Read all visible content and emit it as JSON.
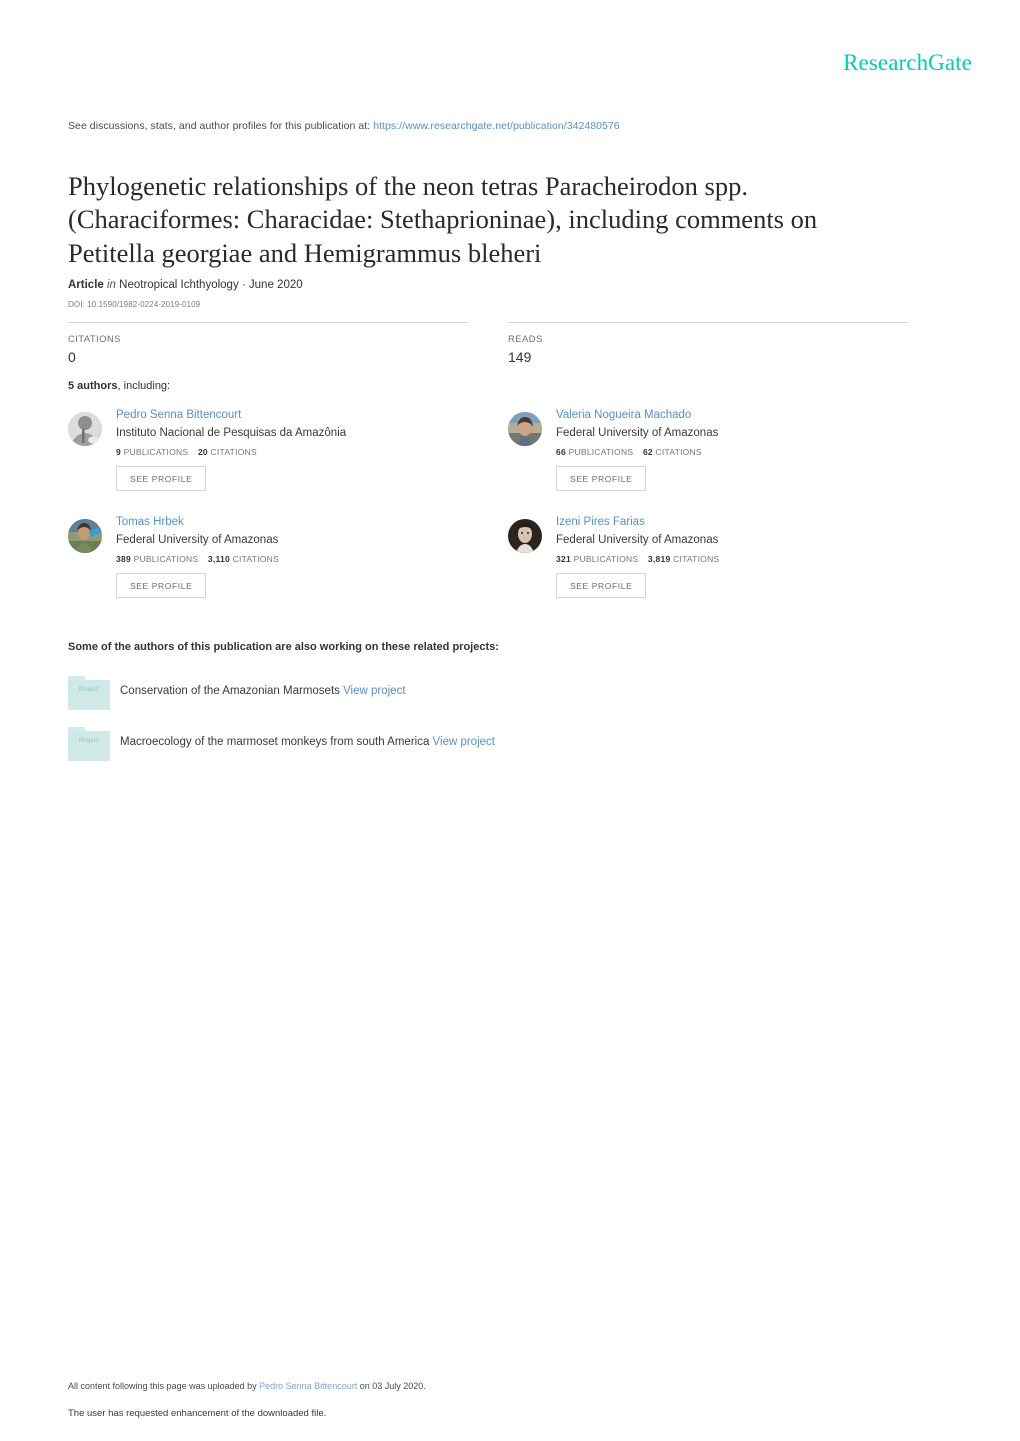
{
  "brand": {
    "logo_text": "ResearchGate",
    "logo_color": "#00ccbb"
  },
  "discuss": {
    "prefix": "See discussions, stats, and author profiles for this publication at:",
    "url": "https://www.researchgate.net/publication/342480576"
  },
  "publication": {
    "title": "Phylogenetic relationships of the neon tetras Paracheirodon spp. (Characiformes: Characidae: Stethaprioninae), including comments on Petitella georgiae and Hemigrammus bleheri",
    "type_label": "Article",
    "type_connector": "in",
    "journal": "Neotropical Ichthyology",
    "date": "June 2020",
    "journal_and_date": "Neotropical Ichthyology · June 2020",
    "doi": "DOI: 10.1590/1982-0224-2019-0109"
  },
  "stats": {
    "citations": {
      "label": "CITATIONS",
      "value": "0"
    },
    "reads": {
      "label": "READS",
      "value": "149"
    }
  },
  "authors_section": {
    "count_label": "5 authors",
    "count_suffix": ", including:",
    "see_profile_label": "SEE PROFILE",
    "publications_label": "PUBLICATIONS",
    "citations_label": "CITATIONS",
    "authors": [
      {
        "name": "Pedro Senna Bittencourt",
        "affiliation": "Instituto Nacional de Pesquisas da Amazônia",
        "publications": "9",
        "citations": "20",
        "see_profile": "SEE PROFILE"
      },
      {
        "name": "Valeria Nogueira Machado",
        "affiliation": "Federal University of Amazonas",
        "publications": "66",
        "citations": "62",
        "see_profile": "SEE PROFILE"
      },
      {
        "name": "Tomas Hrbek",
        "affiliation": "Federal University of Amazonas",
        "publications": "389",
        "citations": "3,110",
        "see_profile": "SEE PROFILE"
      },
      {
        "name": "Izeni Pires Farias",
        "affiliation": "Federal University of Amazonas",
        "publications": "321",
        "citations": "3,819",
        "see_profile": "SEE PROFILE"
      }
    ]
  },
  "projects_section": {
    "heading": "Some of the authors of this publication are also working on these related projects:",
    "folder_word": "Project",
    "view_project_label": "View project",
    "projects": [
      {
        "title": "Conservation of the Amazonian Marmosets",
        "link": "View project"
      },
      {
        "title": "Macroecology of the marmoset monkeys from south America",
        "link": "View project"
      }
    ]
  },
  "footer": {
    "upload_prefix": "All content following this page was uploaded by",
    "uploader": "Pedro Senna Bittencourt",
    "upload_suffix": "on 03 July 2020.",
    "enhancement_note": "The user has requested enhancement of the downloaded file."
  },
  "colors": {
    "brand_teal": "#00ccbb",
    "link_blue": "#5a8fc4",
    "text_dark": "#333333",
    "rule_gray": "#d8d8d8",
    "folder_teal": "#cfe9e7"
  }
}
